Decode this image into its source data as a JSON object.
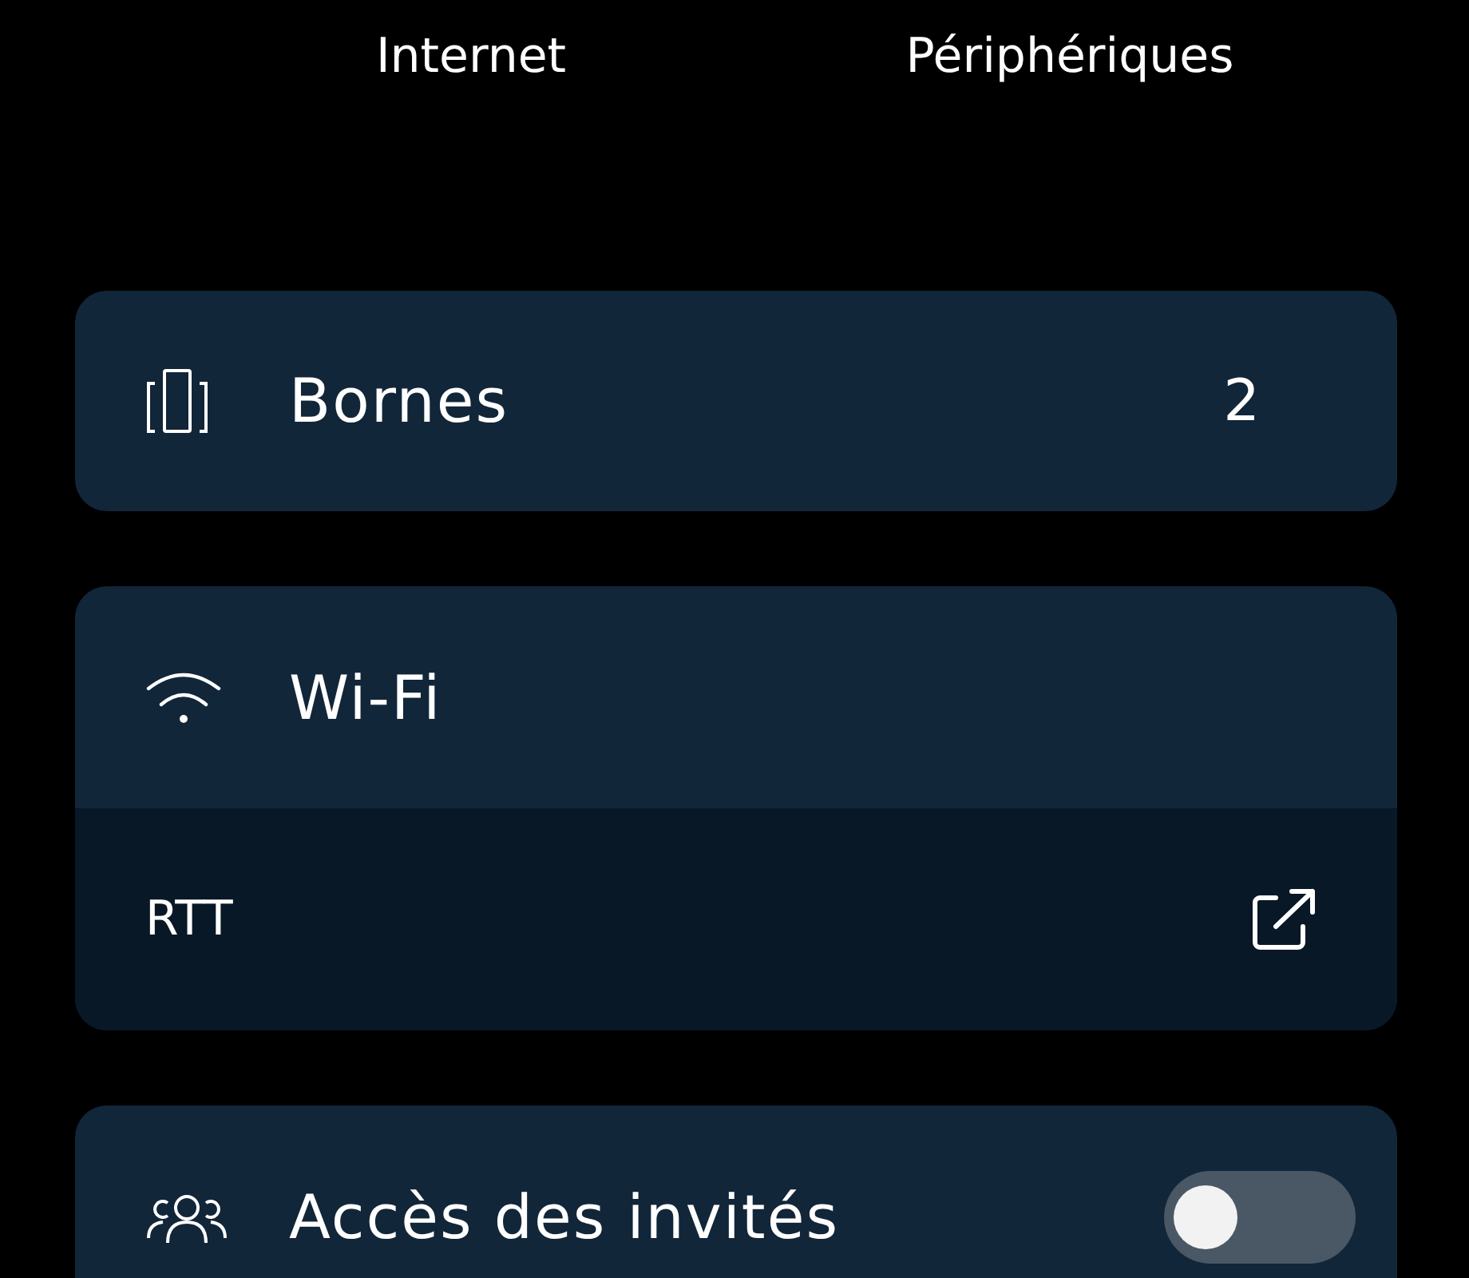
{
  "tabs": [
    {
      "label": "Internet"
    },
    {
      "label": "Périphériques"
    }
  ],
  "nodes_card": {
    "label": "Bornes",
    "count": "2"
  },
  "wifi_card": {
    "label": "Wi-Fi",
    "link": {
      "label": "RTT"
    }
  },
  "guest_card": {
    "label": "Accès des invités",
    "on": false
  }
}
